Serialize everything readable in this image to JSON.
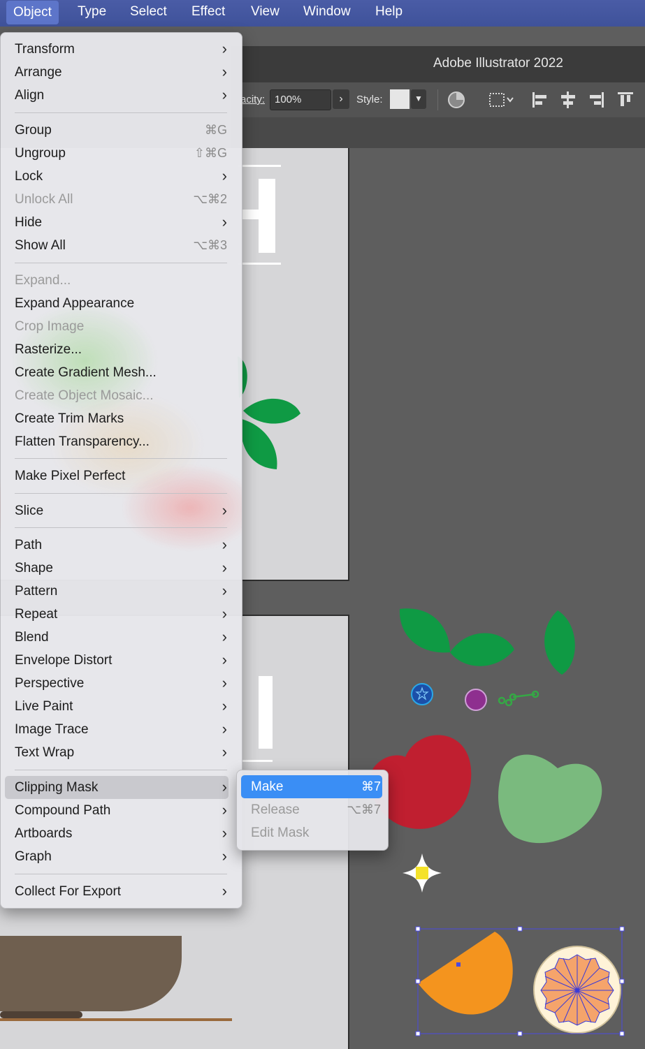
{
  "menubar": {
    "items": [
      "Object",
      "Type",
      "Select",
      "Effect",
      "View",
      "Window",
      "Help"
    ],
    "active": "Object"
  },
  "window": {
    "title": "Adobe Illustrator 2022"
  },
  "controlbar": {
    "opacity_label": "acity:",
    "opacity_value": "100%",
    "style_label": "Style:"
  },
  "object_menu": {
    "items": [
      {
        "label": "Transform",
        "submenu": true
      },
      {
        "label": "Arrange",
        "submenu": true
      },
      {
        "label": "Align",
        "submenu": true
      },
      {
        "label": "Group",
        "shortcut": "⌘G"
      },
      {
        "label": "Ungroup",
        "shortcut": "⇧⌘G"
      },
      {
        "label": "Lock",
        "submenu": true
      },
      {
        "label": "Unlock All",
        "shortcut": "⌥⌘2",
        "disabled": true
      },
      {
        "label": "Hide",
        "submenu": true
      },
      {
        "label": "Show All",
        "shortcut": "⌥⌘3"
      },
      {
        "label": "Expand...",
        "disabled": true
      },
      {
        "label": "Expand Appearance"
      },
      {
        "label": "Crop Image",
        "disabled": true
      },
      {
        "label": "Rasterize..."
      },
      {
        "label": "Create Gradient Mesh..."
      },
      {
        "label": "Create Object Mosaic...",
        "disabled": true
      },
      {
        "label": "Create Trim Marks"
      },
      {
        "label": "Flatten Transparency..."
      },
      {
        "label": "Make Pixel Perfect"
      },
      {
        "label": "Slice",
        "submenu": true
      },
      {
        "label": "Path",
        "submenu": true
      },
      {
        "label": "Shape",
        "submenu": true
      },
      {
        "label": "Pattern",
        "submenu": true
      },
      {
        "label": "Repeat",
        "submenu": true
      },
      {
        "label": "Blend",
        "submenu": true
      },
      {
        "label": "Envelope Distort",
        "submenu": true
      },
      {
        "label": "Perspective",
        "submenu": true
      },
      {
        "label": "Live Paint",
        "submenu": true
      },
      {
        "label": "Image Trace",
        "submenu": true
      },
      {
        "label": "Text Wrap",
        "submenu": true
      },
      {
        "label": "Clipping Mask",
        "submenu": true,
        "highlighted": true
      },
      {
        "label": "Compound Path",
        "submenu": true
      },
      {
        "label": "Artboards",
        "submenu": true
      },
      {
        "label": "Graph",
        "submenu": true
      },
      {
        "label": "Collect For Export",
        "submenu": true
      }
    ]
  },
  "clipping_mask_submenu": {
    "items": [
      {
        "label": "Make",
        "shortcut": "⌘7",
        "selected": true
      },
      {
        "label": "Release",
        "shortcut": "⌥⌘7",
        "disabled": true
      },
      {
        "label": "Edit Mask",
        "disabled": true
      }
    ]
  },
  "colors": {
    "menubar": "#4356a0",
    "selection_blue": "#3a8ef5",
    "leaf_green": "#0f9a44",
    "apple_red": "#c01f30",
    "light_green": "#7aba7e",
    "orange": "#f4941e",
    "purple": "#8e2f8f",
    "blueberry": "#1b4fa8"
  }
}
